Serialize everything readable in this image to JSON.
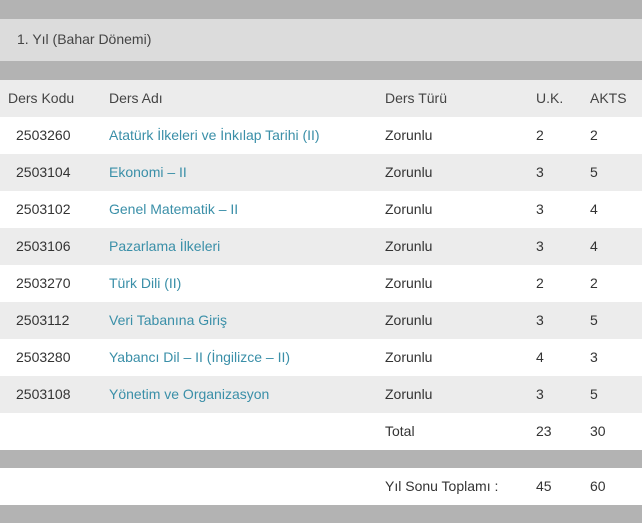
{
  "semester": {
    "title": "1. Yıl (Bahar Dönemi)"
  },
  "table": {
    "headers": {
      "code": "Ders Kodu",
      "name": "Ders Adı",
      "type": "Ders Türü",
      "uk": "U.K.",
      "akts": "AKTS"
    },
    "rows": [
      {
        "code": "2503260",
        "name": "Atatürk İlkeleri ve İnkılap Tarihi (II)",
        "type": "Zorunlu",
        "uk": "2",
        "akts": "2"
      },
      {
        "code": "2503104",
        "name": "Ekonomi – II",
        "type": "Zorunlu",
        "uk": "3",
        "akts": "5"
      },
      {
        "code": "2503102",
        "name": "Genel Matematik – II",
        "type": "Zorunlu",
        "uk": "3",
        "akts": "4"
      },
      {
        "code": "2503106",
        "name": "Pazarlama İlkeleri",
        "type": "Zorunlu",
        "uk": "3",
        "akts": "4"
      },
      {
        "code": "2503270",
        "name": "Türk Dili (II)",
        "type": "Zorunlu",
        "uk": "2",
        "akts": "2"
      },
      {
        "code": "2503112",
        "name": "Veri Tabanına Giriş",
        "type": "Zorunlu",
        "uk": "3",
        "akts": "5"
      },
      {
        "code": "2503280",
        "name": "Yabancı Dil – II (İngilizce – II)",
        "type": "Zorunlu",
        "uk": "4",
        "akts": "3"
      },
      {
        "code": "2503108",
        "name": "Yönetim ve Organizasyon",
        "type": "Zorunlu",
        "uk": "3",
        "akts": "5"
      }
    ],
    "total": {
      "label": "Total",
      "uk": "23",
      "akts": "30"
    }
  },
  "year_total": {
    "label": "Yıl Sonu Toplamı :",
    "uk": "45",
    "akts": "60"
  },
  "colors": {
    "link": "#3a8fa8",
    "stripe": "#ececec",
    "band": "#dcdcdc",
    "bar": "#b3b3b3"
  }
}
